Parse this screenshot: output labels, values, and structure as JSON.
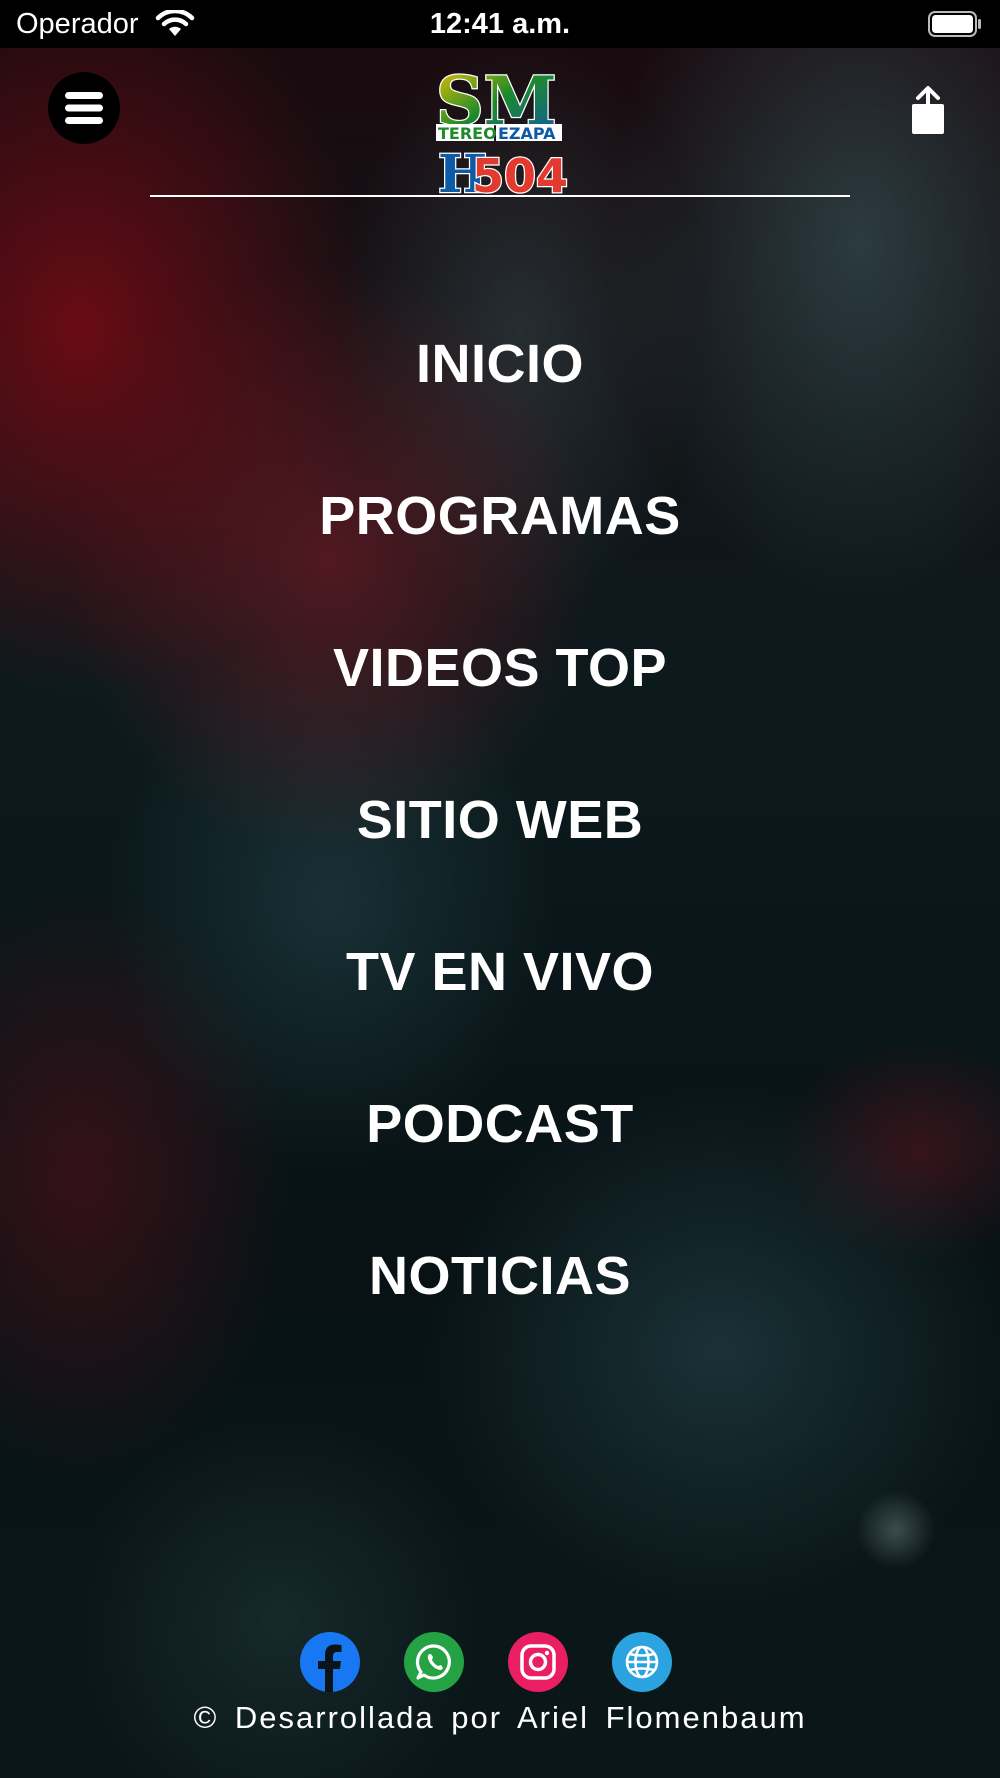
{
  "status_bar": {
    "carrier": "Operador",
    "time": "12:41 a.m."
  },
  "header": {
    "logo_alt": "SM TEREO EZAPA H504",
    "logo_text_top": "SM",
    "logo_text_mid_left": "TEREO",
    "logo_text_mid_right": "EZAPA",
    "logo_text_bottom_left": "H",
    "logo_text_bottom_right": "504",
    "menu_icon": "hamburger-icon",
    "share_icon": "share-icon"
  },
  "menu": {
    "items": [
      {
        "label": "INICIO"
      },
      {
        "label": "PROGRAMAS"
      },
      {
        "label": "VIDEOS TOP"
      },
      {
        "label": "SITIO WEB"
      },
      {
        "label": "TV EN VIVO"
      },
      {
        "label": "PODCAST"
      },
      {
        "label": "NOTICIAS"
      }
    ]
  },
  "footer": {
    "social": [
      {
        "name": "facebook-icon",
        "color": "#1877F2"
      },
      {
        "name": "whatsapp-icon",
        "color": "#25A244"
      },
      {
        "name": "instagram-icon",
        "color": "#E91E63"
      },
      {
        "name": "globe-icon",
        "color": "#2AA3E0"
      }
    ],
    "credit": "© Desarrollada por Ariel Flomenbaum"
  }
}
